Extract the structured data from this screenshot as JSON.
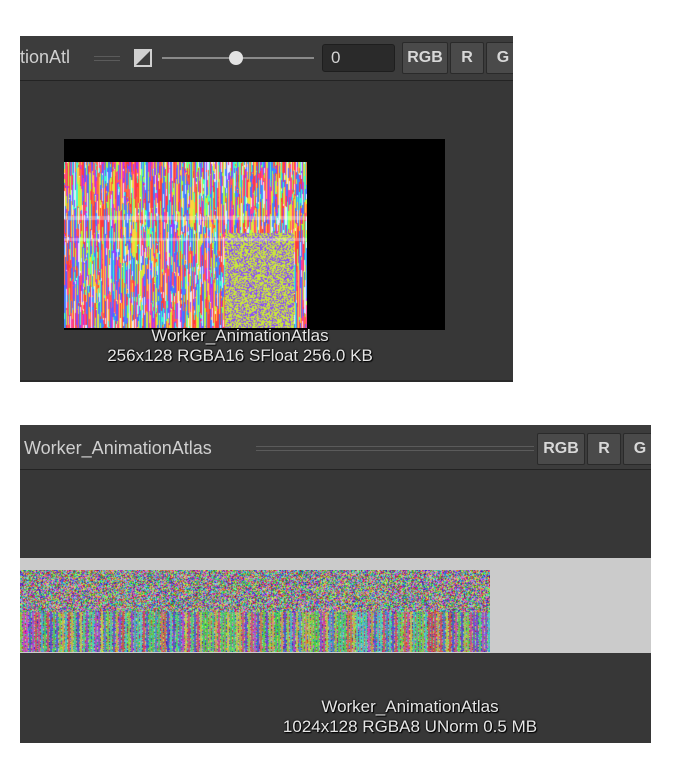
{
  "panel1": {
    "title": "tionAtl",
    "exposure_value": "0",
    "channel_buttons": [
      "RGB",
      "R",
      "G"
    ],
    "icon": "exposure-icon",
    "caption_name": "Worker_AnimationAtlas",
    "caption_info": "256x128  RGBA16 SFloat   256.0 KB"
  },
  "panel2": {
    "title": "Worker_AnimationAtlas",
    "channel_buttons": [
      "RGB",
      "R",
      "G"
    ],
    "caption_name": "Worker_AnimationAtlas",
    "caption_info": "1024x128  RGBA8 UNorm   0.5 MB"
  },
  "colors": {
    "panel_bg": "#373737",
    "toolbar_bg": "#3c3c3c",
    "preview_bg": "#000000",
    "strip_bg": "#cbcbcb"
  }
}
